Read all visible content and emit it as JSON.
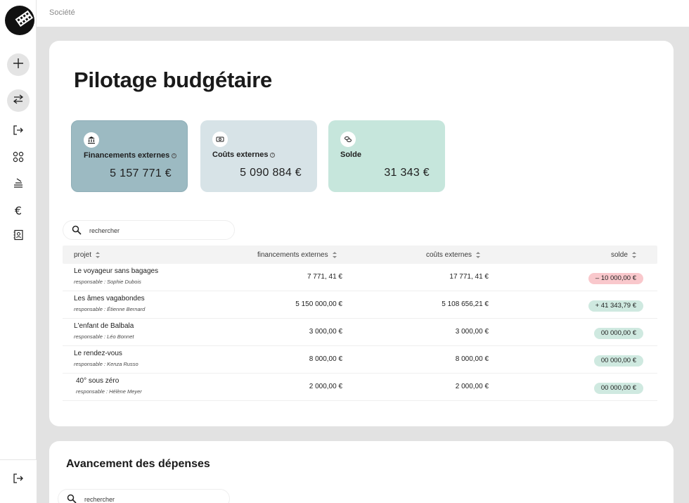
{
  "topbar": {
    "breadcrumb": "Société"
  },
  "page": {
    "title": "Pilotage budgétaire"
  },
  "kpis": [
    {
      "label": "Financements externes",
      "value": "5 157 771 €",
      "icon": "bank-icon",
      "color": "#9cbac2"
    },
    {
      "label": "Coûts externes",
      "value": "5 090 884 €",
      "icon": "banknote-icon",
      "color": "#d7e3e7"
    },
    {
      "label": "Solde",
      "value": "31 343 €",
      "icon": "coins-icon",
      "color": "#c6e6dc"
    }
  ],
  "search": {
    "placeholder": "rechercher"
  },
  "table": {
    "headers": {
      "projet": "projet",
      "financements": "financements externes",
      "couts": "coûts externes",
      "solde": "solde"
    },
    "rows": [
      {
        "name": "Le voyageur sans bagages",
        "resp": "responsable : Sophie Dubois",
        "fin": "7 771, 41 €",
        "cout": "17 771, 41  €",
        "solde": "– 10 000,00 €",
        "status": "negative"
      },
      {
        "name": "Les âmes vagabondes",
        "resp": "responsable : Étienne Bernard",
        "fin": "5 150 000,00 €",
        "cout": "5  108  656,21 €",
        "solde": "+ 41 343,79 €",
        "status": "positive"
      },
      {
        "name": "L'enfant de Balbala",
        "resp": "responsable : Léo Bonnet",
        "fin": "3 000,00 €",
        "cout": "3 000,00 €",
        "solde": "00 000,00 €",
        "status": "positive"
      },
      {
        "name": "Le rendez-vous",
        "resp": "responsable : Kenza Russo",
        "fin": "8 000,00 €",
        "cout": "8 000,00 €",
        "solde": "00 000,00 €",
        "status": "positive"
      },
      {
        "name": "40° sous zéro",
        "resp": "responsable : Hélène Meyer",
        "fin": "2 000,00 €",
        "cout": "2 000,00 €",
        "solde": "00 000,00 €",
        "status": "positive"
      }
    ]
  },
  "section2": {
    "title": "Avancement des dépenses",
    "search_placeholder": "rechercher"
  },
  "sidebar": {
    "icons": [
      "plus-icon",
      "swap-icon",
      "logout-icon",
      "grid-icon",
      "stack-icon",
      "euro-icon",
      "contacts-icon"
    ],
    "bottom_icon": "logout-icon"
  }
}
